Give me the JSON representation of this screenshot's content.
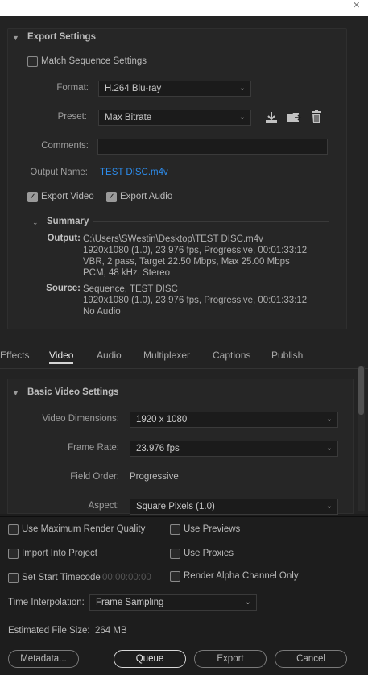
{
  "window": {
    "close_glyph": "×"
  },
  "export_settings": {
    "title": "Export Settings",
    "match_sequence": "Match Sequence Settings",
    "format_label": "Format:",
    "format_value": "H.264 Blu-ray",
    "preset_label": "Preset:",
    "preset_value": "Max Bitrate",
    "comments_label": "Comments:",
    "comments_value": "",
    "output_name_label": "Output Name:",
    "output_name_value": "TEST DISC.m4v",
    "export_video": "Export Video",
    "export_audio": "Export Audio",
    "summary": {
      "title": "Summary",
      "output_label": "Output:",
      "output_lines": [
        "C:\\Users\\SWestin\\Desktop\\TEST DISC.m4v",
        "1920x1080 (1.0), 23.976 fps, Progressive, 00:01:33:12",
        "VBR, 2 pass, Target 22.50 Mbps, Max 25.00 Mbps",
        "PCM, 48 kHz, Stereo"
      ],
      "source_label": "Source:",
      "source_lines": [
        "Sequence, TEST DISC",
        "1920x1080 (1.0), 23.976 fps, Progressive, 00:01:33:12",
        "No Audio"
      ]
    }
  },
  "tabs": [
    "Effects",
    "Video",
    "Audio",
    "Multiplexer",
    "Captions",
    "Publish"
  ],
  "active_tab": "Video",
  "video": {
    "title": "Basic Video Settings",
    "dimensions_label": "Video Dimensions:",
    "dimensions_value": "1920 x 1080",
    "frame_rate_label": "Frame Rate:",
    "frame_rate_value": "23.976 fps",
    "field_order_label": "Field Order:",
    "field_order_value": "Progressive",
    "aspect_label": "Aspect:",
    "aspect_value": "Square Pixels (1.0)"
  },
  "bottom": {
    "max_render_quality": "Use Maximum Render Quality",
    "use_previews": "Use Previews",
    "import_into_project": "Import Into Project",
    "use_proxies": "Use Proxies",
    "set_start_timecode": "Set Start Timecode",
    "timecode_value": "00:00:00:00",
    "render_alpha": "Render Alpha Channel Only",
    "time_interp_label": "Time Interpolation:",
    "time_interp_value": "Frame Sampling",
    "file_size_label": "Estimated File Size:",
    "file_size_value": "264 MB",
    "metadata_btn": "Metadata...",
    "queue_btn": "Queue",
    "export_btn": "Export",
    "cancel_btn": "Cancel"
  },
  "icons": {
    "save_preset": "download-icon",
    "import_preset": "import-folder-icon",
    "delete_preset": "trash-icon",
    "dropdown": "chevron-down-icon"
  }
}
